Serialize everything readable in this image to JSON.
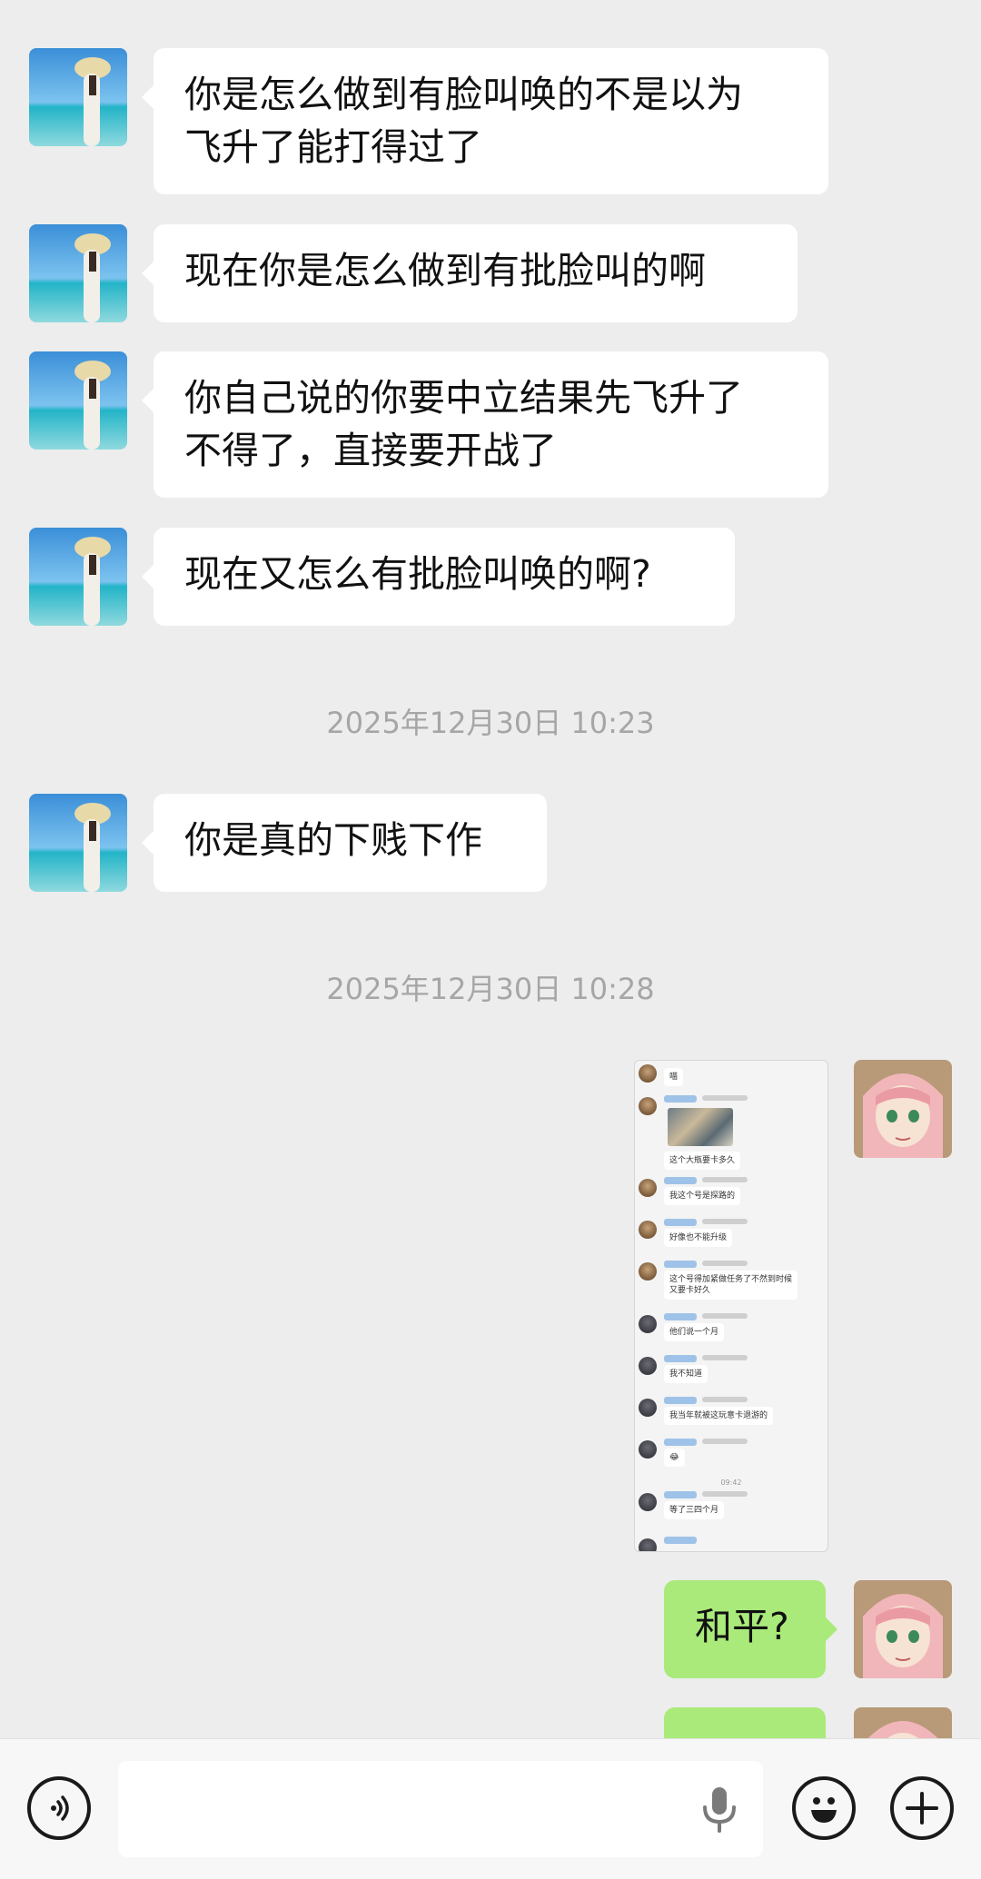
{
  "messages": [
    {
      "text": "你是怎么做到有脸叫唤的不是以为\n飞升了能打得过了"
    },
    {
      "text": "现在你是怎么做到有批脸叫的啊"
    },
    {
      "text": "你自己说的你要中立结果先飞升了\n不得了，直接要开战了"
    },
    {
      "text": "现在又怎么有批脸叫唤的啊?"
    },
    {
      "text": "你是真的下贱下作"
    },
    {
      "text": "和平?"
    }
  ],
  "timestamps": [
    "2025年12月30日 10:23",
    "2025年12月30日 10:28"
  ],
  "screenshot_message": {
    "rows": [
      "喵",
      "这个大瓶要卡多久",
      "我这个号是探路的",
      "好像也不能升级",
      "这个号得加紧做任务了不然到时候\n又要卡好久",
      "他们说一个月",
      "我不知道",
      "我当年就被这玩意卡退游的",
      "😂",
      "等了三四个月"
    ],
    "time": "09:42"
  },
  "input_bar": {
    "voice_icon": "voice-icon",
    "mic_icon": "mic-icon",
    "emoji_icon": "emoji-icon",
    "plus_icon": "plus-icon",
    "input_value": ""
  },
  "colors": {
    "background": "#ededed",
    "bubble_in": "#ffffff",
    "bubble_out": "#a9ea7a",
    "timestamp": "#a6a6a6"
  }
}
